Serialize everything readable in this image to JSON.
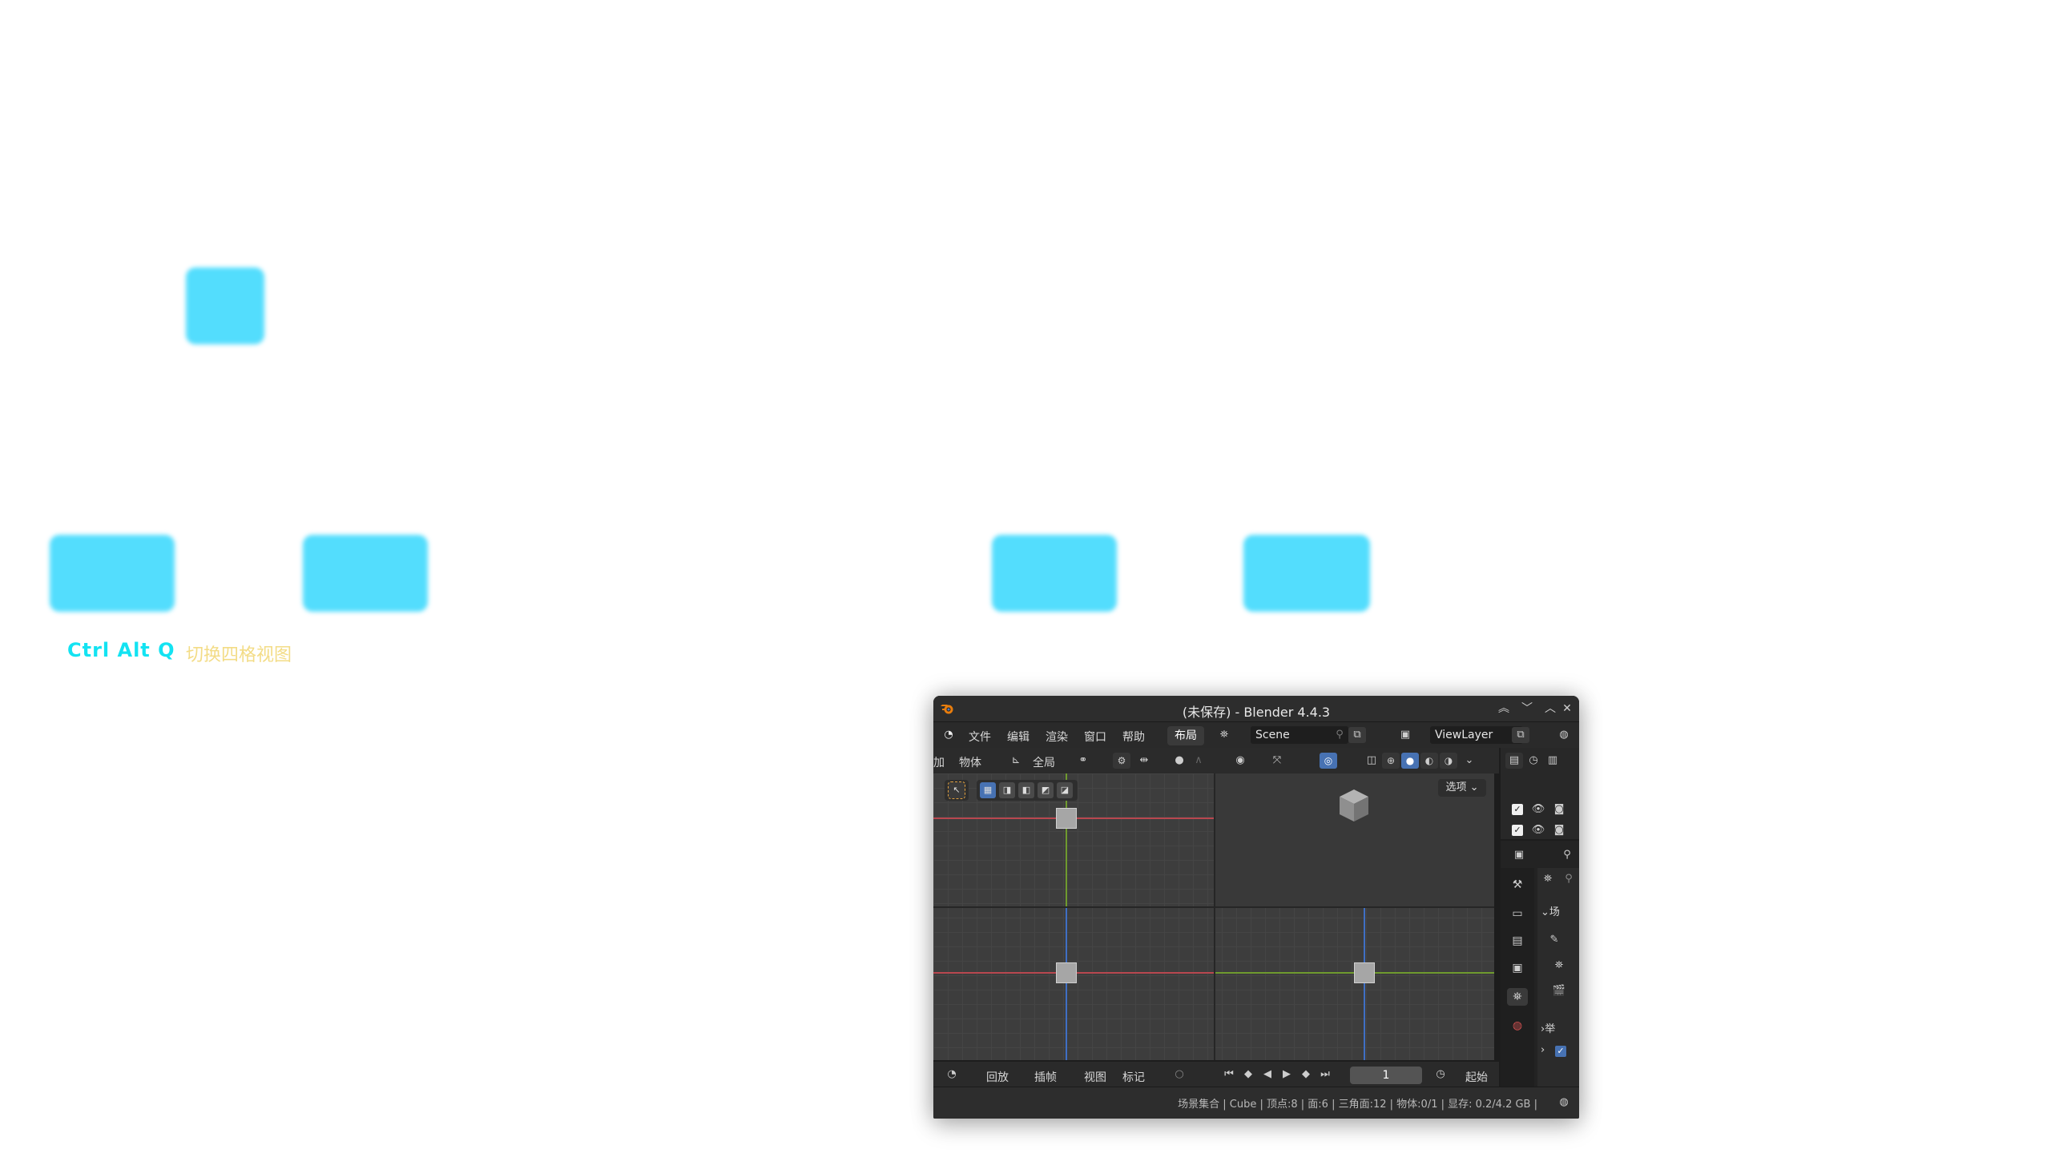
{
  "overlay": {
    "shortcut_keys": "Ctrl Alt Q",
    "shortcut_description": "切换四格视图"
  },
  "window": {
    "title": "(未保存) - Blender 4.4.3",
    "controls": [
      "chevrons-up-icon",
      "chevron-down-icon",
      "chevron-up-icon",
      "close-icon"
    ]
  },
  "menubar": {
    "items": [
      "文件",
      "编辑",
      "渲染",
      "窗口",
      "帮助"
    ],
    "active_workspace": "布局",
    "scene_name": "Scene",
    "view_layer_name": "ViewLayer"
  },
  "viewport_header": {
    "menu_partial": "加",
    "object_menu": "物体",
    "transform_orientation": "全局",
    "options_label": "选项"
  },
  "timeline": {
    "playback": "回放",
    "keying": "插帧",
    "view": "视图",
    "marker": "标记",
    "current_frame": "1",
    "start_label": "起始"
  },
  "properties": {
    "scene_section": "场",
    "world_section": "举"
  },
  "statusbar": {
    "text": "场景集合 | Cube | 顶点:8 | 面:6 | 三角面:12 | 物体:0/1 | 显存: 0.2/4.2 GB |"
  },
  "colors": {
    "key_cap": "#53ddfd",
    "shortcut_keys": "#13e3f2",
    "shortcut_description": "#f3dc86",
    "x_axis": "#b8474f",
    "y_axis": "#6f9a2e",
    "z_axis": "#3f6fc4",
    "active_button": "#4772b3"
  }
}
